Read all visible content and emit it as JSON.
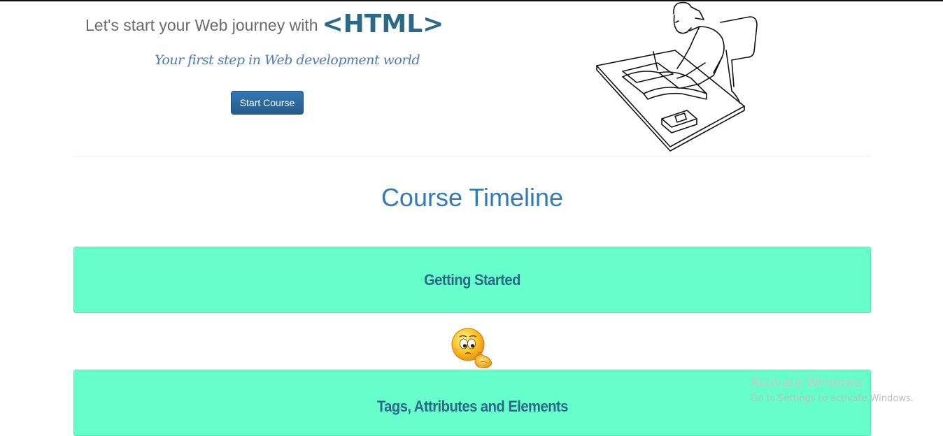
{
  "hero": {
    "title_prefix": "Let's start your Web journey with",
    "title_tag": "<HTML>",
    "subtitle": "Your first step in Web development world",
    "start_button_label": "Start Course",
    "illustration": "student-studying-at-desk-illustration"
  },
  "timeline": {
    "heading": "Course Timeline",
    "items": [
      {
        "label": "Getting Started"
      },
      {
        "label": "Tags, Attributes and Elements"
      }
    ],
    "connector_icon": "thinking-emoji-icon"
  },
  "watermark": {
    "title": "Activate Windows",
    "subtitle": "Go to Settings to activate Windows."
  },
  "colors": {
    "primary": "#337ab7",
    "accent_dark": "#2b6a86",
    "card_background": "#66ffcc",
    "muted_text": "#6b6b6b"
  }
}
